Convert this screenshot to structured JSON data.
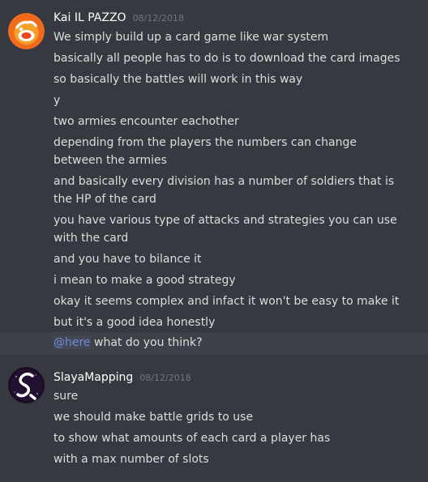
{
  "messages": [
    {
      "author": "Kai IL PAZZO",
      "timestamp": "08/12/2018",
      "avatar_icon": "orange-cartoon-face-avatar",
      "lines": [
        "We simply build up a card game like war system",
        "basically all people has to do is to download the card images",
        "so basically the battles will work in this way",
        "y",
        "two armies encounter eachother",
        "depending from the players the numbers can change between the armies",
        "and basically every division has a number of soldiers that is the HP of the card",
        "you have various type of attacks and strategies you can use with the card",
        "and you have to bilance it",
        "i mean to make a good strategy",
        "okay it seems complex and infact it won't be easy to make it",
        "but it's a good idea honestly"
      ],
      "mention_line": {
        "mention": "@here",
        "text": " what do you think?"
      }
    },
    {
      "author": "SlayaMapping",
      "timestamp": "08/12/2018",
      "avatar_icon": "s-logo-avatar",
      "lines": [
        "sure",
        "we should make battle grids to use",
        "to show what amounts of each card a player has",
        "with a max number of slots"
      ]
    }
  ],
  "colors": {
    "background": "#36393f",
    "username": "#ffffff",
    "timestamp": "#72767d",
    "text": "#dcddde",
    "mention": "#7289da",
    "highlight": "#3e4147"
  }
}
